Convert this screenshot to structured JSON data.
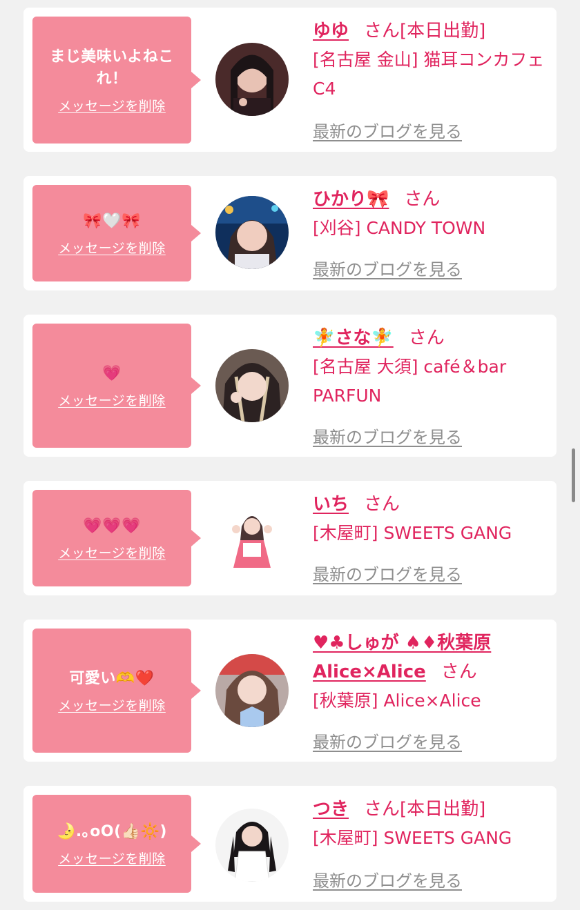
{
  "delete_label": "メッセージを削除",
  "blog_label": "最新のブログを見る",
  "san_label": "さん",
  "colors": {
    "bubble": "#f48b9b",
    "accent": "#e0245e",
    "link_gray": "#8e8e8e",
    "background": "#f1f1f1"
  },
  "cards": [
    {
      "message": "まじ美味いよねこれ！",
      "name": "ゆゆ",
      "tag": "[本日出勤]",
      "shop": "[名古屋 金山] 猫耳コンカフェ C4",
      "avatar": "avatar-photo"
    },
    {
      "message": "🎀🤍🎀",
      "name": "ひかり🎀",
      "tag": "",
      "shop": "[刈谷] CANDY TOWN",
      "avatar": "avatar-photo"
    },
    {
      "message": "💗",
      "name": "🧚さな🧚",
      "tag": "",
      "shop": "[名古屋 大須] café＆bar PARFUN",
      "avatar": "avatar-photo"
    },
    {
      "message": "💗💗💗",
      "name": "いち",
      "tag": "",
      "shop": "[木屋町] SWEETS GANG",
      "avatar": "avatar-photo"
    },
    {
      "message": "可愛い🫶❤️",
      "name": "♥♣しゅが ♠♦秋葉原Alice×Alice",
      "tag": "",
      "shop": "[秋葉原] Alice×Alice",
      "avatar": "avatar-photo"
    },
    {
      "message": "🌛.｡oO(👍🏻🔆)",
      "name": "つき",
      "tag": "[本日出勤]",
      "shop": "[木屋町] SWEETS GANG",
      "avatar": "avatar-photo"
    }
  ]
}
